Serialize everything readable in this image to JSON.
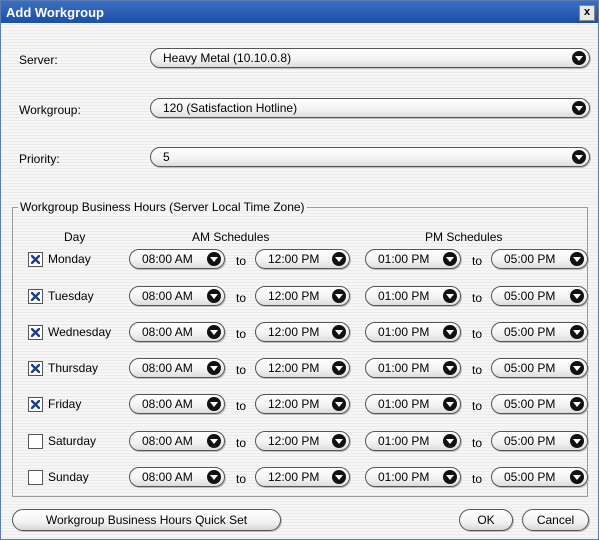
{
  "window": {
    "title": "Add Workgroup",
    "close_glyph": "x"
  },
  "fields": {
    "server": {
      "label": "Server:",
      "value": "Heavy Metal (10.10.0.8)"
    },
    "workgroup": {
      "label": "Workgroup:",
      "value": "120 (Satisfaction Hotline)"
    },
    "priority": {
      "label": "Priority:",
      "value": "5"
    }
  },
  "hours": {
    "legend": "Workgroup Business Hours (Server Local Time Zone)",
    "col_day": "Day",
    "col_am": "AM Schedules",
    "col_pm": "PM Schedules",
    "to_label": "to",
    "rows": [
      {
        "day": "Monday",
        "checked": true,
        "am_start": "08:00 AM",
        "am_end": "12:00 PM",
        "pm_start": "01:00 PM",
        "pm_end": "05:00 PM"
      },
      {
        "day": "Tuesday",
        "checked": true,
        "am_start": "08:00 AM",
        "am_end": "12:00 PM",
        "pm_start": "01:00 PM",
        "pm_end": "05:00 PM"
      },
      {
        "day": "Wednesday",
        "checked": true,
        "am_start": "08:00 AM",
        "am_end": "12:00 PM",
        "pm_start": "01:00 PM",
        "pm_end": "05:00 PM"
      },
      {
        "day": "Thursday",
        "checked": true,
        "am_start": "08:00 AM",
        "am_end": "12:00 PM",
        "pm_start": "01:00 PM",
        "pm_end": "05:00 PM"
      },
      {
        "day": "Friday",
        "checked": true,
        "am_start": "08:00 AM",
        "am_end": "12:00 PM",
        "pm_start": "01:00 PM",
        "pm_end": "05:00 PM"
      },
      {
        "day": "Saturday",
        "checked": false,
        "am_start": "08:00 AM",
        "am_end": "12:00 PM",
        "pm_start": "01:00 PM",
        "pm_end": "05:00 PM"
      },
      {
        "day": "Sunday",
        "checked": false,
        "am_start": "08:00 AM",
        "am_end": "12:00 PM",
        "pm_start": "01:00 PM",
        "pm_end": "05:00 PM"
      }
    ]
  },
  "buttons": {
    "quick_set": "Workgroup Business Hours Quick Set",
    "ok": "OK",
    "cancel": "Cancel"
  },
  "colors": {
    "titlebar": "#1b4fa8",
    "checkmark": "#1c3f8a"
  }
}
